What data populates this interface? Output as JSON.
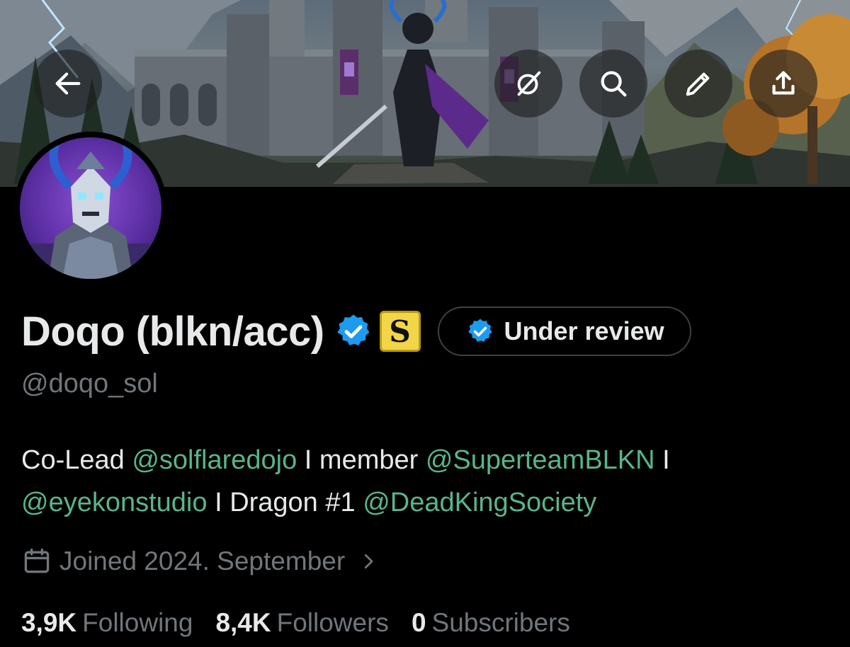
{
  "header": {
    "buttons": [
      {
        "name": "back",
        "icon": "arrow-left-icon"
      },
      {
        "name": "grok",
        "icon": "grok-icon"
      },
      {
        "name": "search",
        "icon": "search-icon"
      },
      {
        "name": "edit",
        "icon": "pencil-icon"
      },
      {
        "name": "share",
        "icon": "share-icon"
      }
    ]
  },
  "profile": {
    "display_name": "Doqo (blkn/acc)",
    "affiliate_glyph": "S",
    "review_label": "Under review",
    "handle": "@doqo_sol",
    "bio": {
      "line1": [
        {
          "text": "Co-Lead ",
          "mention": false
        },
        {
          "text": "@solflaredojo",
          "mention": true
        },
        {
          "text": " I member ",
          "mention": false
        },
        {
          "text": "@SuperteamBLKN",
          "mention": true
        },
        {
          "text": " I",
          "mention": false
        }
      ],
      "line2": [
        {
          "text": "@eyekonstudio",
          "mention": true
        },
        {
          "text": " I Dragon #1 ",
          "mention": false
        },
        {
          "text": "@DeadKingSociety",
          "mention": true
        }
      ]
    },
    "joined": "Joined 2024. September",
    "stats": {
      "following_count": "3,9K",
      "following_label": "Following",
      "followers_count": "8,4K",
      "followers_label": "Followers",
      "subscribers_count": "0",
      "subscribers_label": "Subscribers"
    }
  },
  "colors": {
    "background": "#000000",
    "text_primary": "#e7e9ea",
    "text_secondary": "#71767b",
    "mention": "#59b48a",
    "verified_blue": "#1d9bf0",
    "affiliate_gold": "#f2d648"
  }
}
